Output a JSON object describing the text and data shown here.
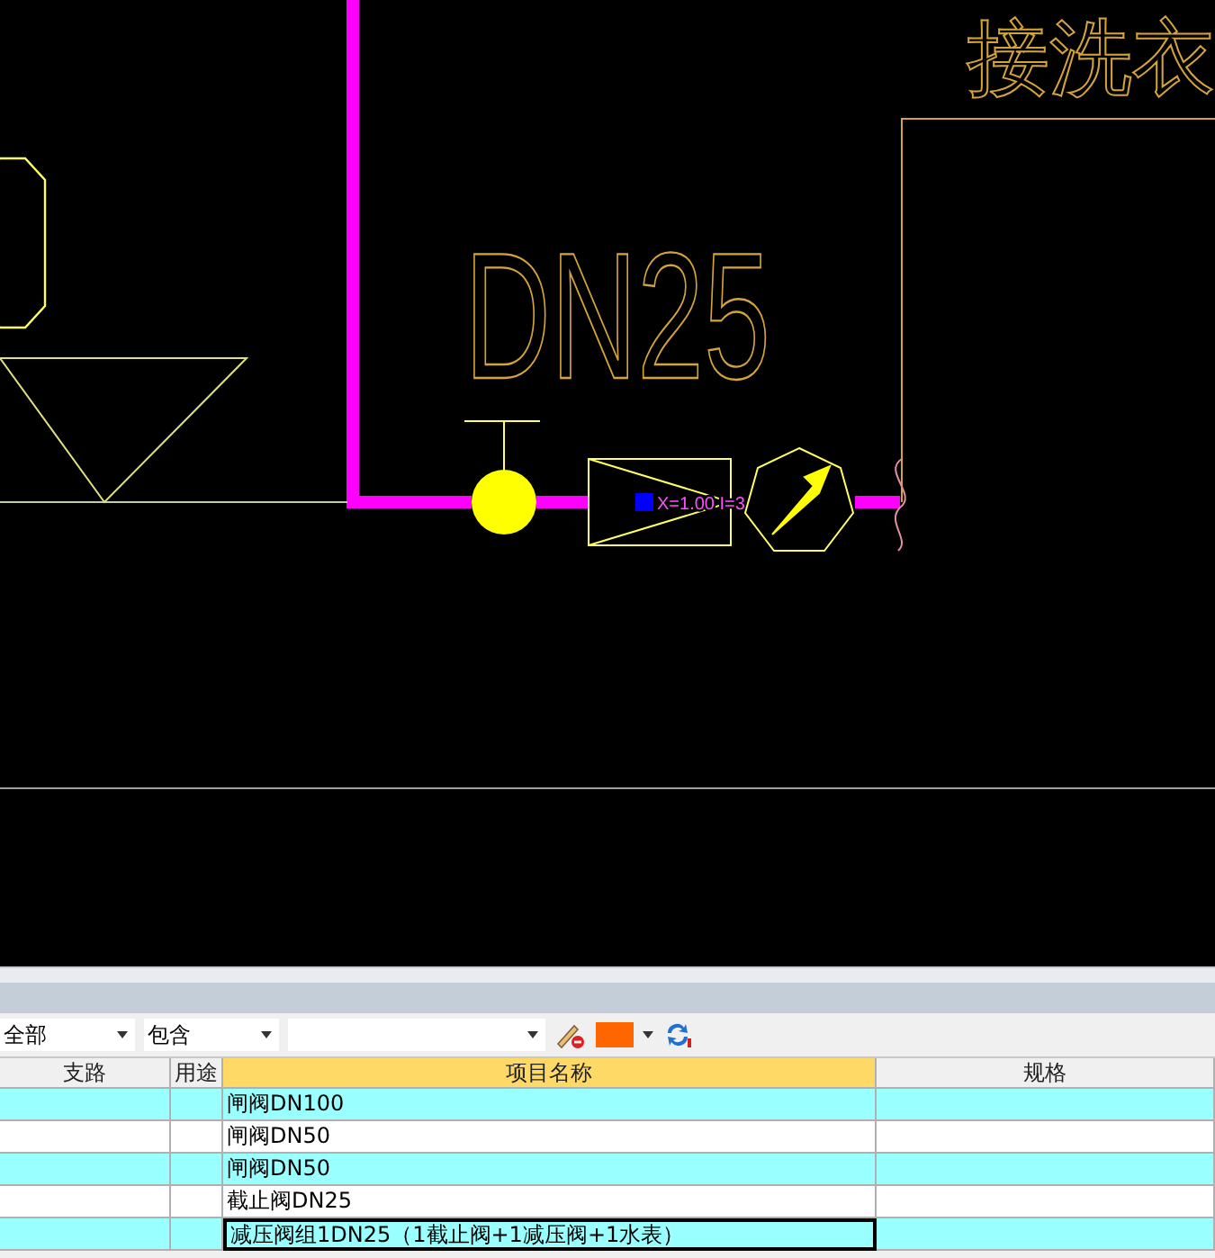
{
  "drawing": {
    "room_label": "接洗衣",
    "pipe_label": "DN25",
    "valve_label": "X=1.00 I=3"
  },
  "toolbar": {
    "filters": [
      {
        "kind": "dropdown",
        "value": "全部"
      },
      {
        "kind": "dropdown",
        "value": "包含"
      },
      {
        "kind": "dropdown"
      }
    ]
  },
  "table": {
    "columns": [
      {
        "label": "支路",
        "selected": false
      },
      {
        "label": "用途",
        "selected": false
      },
      {
        "label": "项目名称",
        "selected": true
      },
      {
        "label": "规格",
        "selected": false
      }
    ],
    "rows": [
      {
        "cells": [
          "",
          "",
          "闸阀DN100",
          ""
        ],
        "selected": false
      },
      {
        "cells": [
          "",
          "",
          "闸阀DN50",
          ""
        ],
        "selected": false
      },
      {
        "cells": [
          "",
          "",
          "闸阀DN50",
          ""
        ],
        "selected": false
      },
      {
        "cells": [
          "",
          "",
          "截止阀DN25",
          ""
        ],
        "selected": false
      },
      {
        "cells": [
          "",
          "",
          "减压阀组1DN25（1截止阀+1减压阀+1水表）",
          ""
        ],
        "selected": true
      }
    ]
  }
}
